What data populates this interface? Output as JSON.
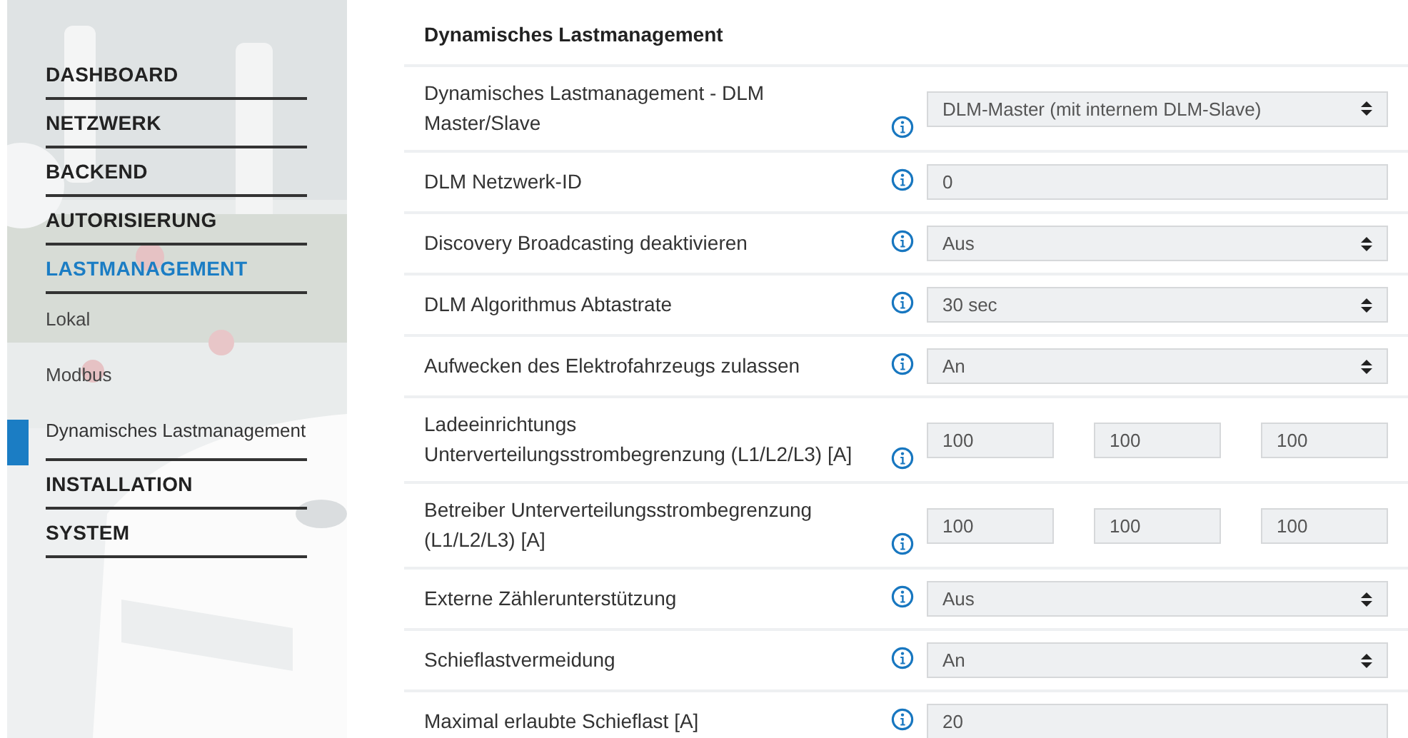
{
  "sidebar": {
    "items": [
      {
        "label": "DASHBOARD",
        "kind": "section",
        "selected": false
      },
      {
        "label": "NETZWERK",
        "kind": "section",
        "selected": false
      },
      {
        "label": "BACKEND",
        "kind": "section",
        "selected": false
      },
      {
        "label": "AUTORISIERUNG",
        "kind": "section",
        "selected": false
      },
      {
        "label": "LASTMANAGEMENT",
        "kind": "section",
        "selected": true
      },
      {
        "label": "Lokal",
        "kind": "sub",
        "selected": false
      },
      {
        "label": "Modbus",
        "kind": "sub",
        "selected": false
      },
      {
        "label": "Dynamisches Lastmanagement",
        "kind": "sub",
        "selected": true
      },
      {
        "label": "INSTALLATION",
        "kind": "section",
        "selected": false
      },
      {
        "label": "SYSTEM",
        "kind": "section",
        "selected": false
      }
    ]
  },
  "form": {
    "title": "Dynamisches Lastmanagement",
    "rows": [
      {
        "label": "Dynamisches Lastmanagement - DLM Master/Slave",
        "kind": "select",
        "value": "DLM-Master (mit internem DLM-Slave)"
      },
      {
        "label": "DLM Netzwerk-ID",
        "kind": "input",
        "value": "0"
      },
      {
        "label": "Discovery Broadcasting deaktivieren",
        "kind": "select",
        "value": "Aus"
      },
      {
        "label": "DLM Algorithmus Abtastrate",
        "kind": "select",
        "value": "30 sec"
      },
      {
        "label": "Aufwecken des Elektrofahrzeugs zulassen",
        "kind": "select",
        "value": "An"
      },
      {
        "label": "Ladeeinrichtungs Unterverteilungsstrombegrenzung (L1/L2/L3) [A]",
        "kind": "triple",
        "values": [
          "100",
          "100",
          "100"
        ]
      },
      {
        "label": "Betreiber Unterverteilungsstrombegrenzung (L1/L2/L3) [A]",
        "kind": "triple",
        "values": [
          "100",
          "100",
          "100"
        ]
      },
      {
        "label": "Externe Zählerunterstützung",
        "kind": "select",
        "value": "Aus"
      },
      {
        "label": "Schieflastvermeidung",
        "kind": "select",
        "value": "An"
      },
      {
        "label": "Maximal erlaubte Schieflast [A]",
        "kind": "input",
        "value": "20"
      }
    ]
  }
}
